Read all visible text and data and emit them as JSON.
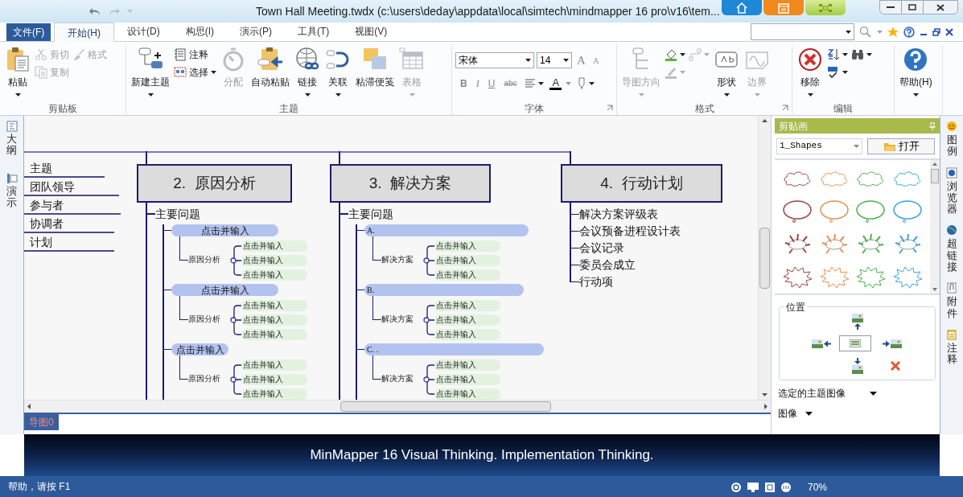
{
  "window": {
    "title": "Town Hall Meeting.twdx (c:\\users\\deday\\appdata\\local\\simtech\\mindmapper 16 pro\\v16\\tem..."
  },
  "menu_tabs": [
    {
      "label": "文件(F)",
      "kind": "file",
      "selected": false
    },
    {
      "label": "开始(H)",
      "kind": "tab",
      "selected": true
    },
    {
      "label": "设计(D)",
      "kind": "tab",
      "selected": false
    },
    {
      "label": "构思(I)",
      "kind": "tab",
      "selected": false
    },
    {
      "label": "演示(P)",
      "kind": "tab",
      "selected": false
    },
    {
      "label": "工具(T)",
      "kind": "tab",
      "selected": false
    },
    {
      "label": "视图(V)",
      "kind": "tab",
      "selected": false
    }
  ],
  "ribbon": [
    {
      "label": "剪贴板",
      "kind": "buttons",
      "columns": [
        [
          {
            "label": "粘贴",
            "kind": "large",
            "dropdown": true,
            "disabled": false
          }
        ],
        [
          {
            "label": "剪切",
            "kind": "small",
            "disabled": true
          },
          {
            "label": "复制",
            "kind": "small",
            "disabled": true
          }
        ],
        [
          {
            "label": "格式",
            "kind": "small",
            "disabled": true
          }
        ]
      ]
    },
    {
      "label": "主题",
      "kind": "buttons",
      "columns": [
        [
          {
            "label": "新建主题",
            "kind": "large",
            "dropdown": true,
            "disabled": false
          }
        ],
        [
          {
            "label": "注释",
            "kind": "small",
            "disabled": false
          },
          {
            "label": "选择",
            "kind": "small",
            "dropdown": true,
            "disabled": false
          }
        ],
        [
          {
            "label": "分配",
            "kind": "large",
            "disabled": true
          }
        ],
        [
          {
            "label": "自动粘贴",
            "kind": "large",
            "disabled": false
          }
        ],
        [
          {
            "label": "链接",
            "kind": "large",
            "dropdown": true,
            "disabled": false
          }
        ],
        [
          {
            "label": "关联",
            "kind": "large",
            "dropdown": true,
            "disabled": false
          }
        ],
        [
          {
            "label": "粘滞便笺",
            "kind": "large",
            "disabled": false
          }
        ],
        [
          {
            "label": "表格",
            "kind": "large",
            "dropdown": true,
            "disabled": true
          }
        ]
      ]
    },
    {
      "label": "字体",
      "kind": "font",
      "launcher": true,
      "font": "宋体",
      "size": "14",
      "row1": [
        {
          "label": "A",
          "kind": "grow"
        },
        {
          "label": "A",
          "kind": "shrink"
        }
      ],
      "row2": [
        {
          "label": "B",
          "kind": "bold"
        },
        {
          "label": "I",
          "kind": "italic"
        },
        {
          "label": "U",
          "kind": "underline"
        },
        {
          "label": "abc",
          "kind": "strike"
        },
        {
          "kind": "align"
        },
        {
          "label": "A",
          "kind": "color"
        },
        {
          "kind": "highlight"
        }
      ]
    },
    {
      "label": "格式",
      "kind": "buttons",
      "launcher": true,
      "columns": [
        [
          {
            "label": "导图方向",
            "kind": "large",
            "dropdown": true,
            "disabled": true
          }
        ],
        [
          {
            "kind": "small",
            "dropdown": true,
            "disabled": false
          },
          {
            "kind": "small",
            "dropdown": true,
            "disabled": true
          }
        ],
        [
          {
            "kind": "small",
            "dropdown": true,
            "disabled": true
          }
        ],
        [
          {
            "label": "形状",
            "kind": "large",
            "dropdown": true,
            "disabled": false
          }
        ],
        [
          {
            "label": "边界",
            "kind": "large",
            "dropdown": true,
            "disabled": true
          }
        ]
      ]
    },
    {
      "label": "编辑",
      "kind": "buttons",
      "columns": [
        [
          {
            "label": "移除",
            "kind": "large",
            "dropdown": true,
            "disabled": false
          }
        ],
        [
          {
            "kind": "small",
            "dropdown": true,
            "disabled": false
          },
          {
            "kind": "small",
            "dropdown": true,
            "disabled": false
          }
        ],
        [
          {
            "kind": "small",
            "dropdown": true,
            "disabled": false
          }
        ]
      ]
    },
    {
      "kind": "buttons",
      "columns": [
        [
          {
            "label": "帮助(H)",
            "kind": "large",
            "dropdown": true,
            "disabled": false
          }
        ]
      ]
    }
  ],
  "left_tabs": [
    "大纲",
    "演示"
  ],
  "map": {
    "left_items": [
      "主题",
      "团队领导",
      "参与者",
      "协调者",
      "计划"
    ],
    "topics": [
      {
        "title": "2.  原因分析",
        "kind": "branches",
        "heading": "主要问题",
        "branches": [
          {
            "label": "点击并输入",
            "child": "原因分析",
            "leaves": [
              "点击并输入",
              "点击并输入",
              "点击并输入"
            ]
          },
          {
            "label": "点击并输入",
            "child": "原因分析",
            "leaves": [
              "点击并输入",
              "点击并输入",
              "点击并输入"
            ]
          },
          {
            "label": "点击并输入",
            "child": "原因分析",
            "leaves": [
              "点击并输入",
              "点击并输入",
              "点击并输入"
            ]
          }
        ]
      },
      {
        "title": "3.  解决方案",
        "kind": "branches",
        "heading": "主要问题",
        "branches": [
          {
            "label": "A.",
            "child": "解决方案",
            "leaves": [
              "点击并输入",
              "点击并输入",
              "点击并输入"
            ]
          },
          {
            "label": "B.",
            "child": "解决方案",
            "leaves": [
              "点击并输入",
              "点击并输入",
              "点击并输入"
            ]
          },
          {
            "label": "C. .",
            "child": "解决方案",
            "leaves": [
              "点击并输入",
              "点击并输入",
              "点击并输入"
            ]
          }
        ]
      },
      {
        "title": "4.  行动计划",
        "kind": "list",
        "items": [
          "解决方案评级表",
          "会议预备进程设计表",
          "会议记录",
          "委员会成立",
          "行动项"
        ]
      }
    ]
  },
  "map_tabs": [
    {
      "label": "导图0",
      "selected": true
    }
  ],
  "clipart_panel": {
    "title": "剪贴画",
    "library": "1_Shapes",
    "open_button": "打开",
    "position_label": "位置",
    "selected_image": "选定的主题图像",
    "image": "图像"
  },
  "right_tabs": [
    "图例",
    "浏览器",
    "超链接",
    "附件",
    "注释"
  ],
  "banner": "MinMapper 16 Visual Thinking. Implementation Thinking.",
  "status_bar": {
    "help": "帮助，请按 F1",
    "zoom": "70%"
  }
}
